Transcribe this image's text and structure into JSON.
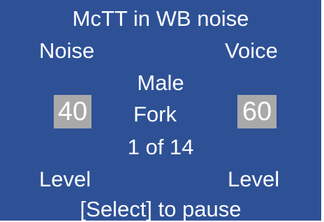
{
  "screen": {
    "title": "McTT in WB noise",
    "noise_label": "Noise",
    "voice_label": "Voice",
    "talker": "Male",
    "noise_level": "40",
    "word": "Fork",
    "voice_level": "60",
    "progress": "1 of 14",
    "left_level_label": "Level",
    "right_level_label": "Level",
    "hint": "[Select] to pause"
  },
  "colors": {
    "background": "#2e5196",
    "text": "#ffffff",
    "level_box": "#a9a9a9"
  }
}
